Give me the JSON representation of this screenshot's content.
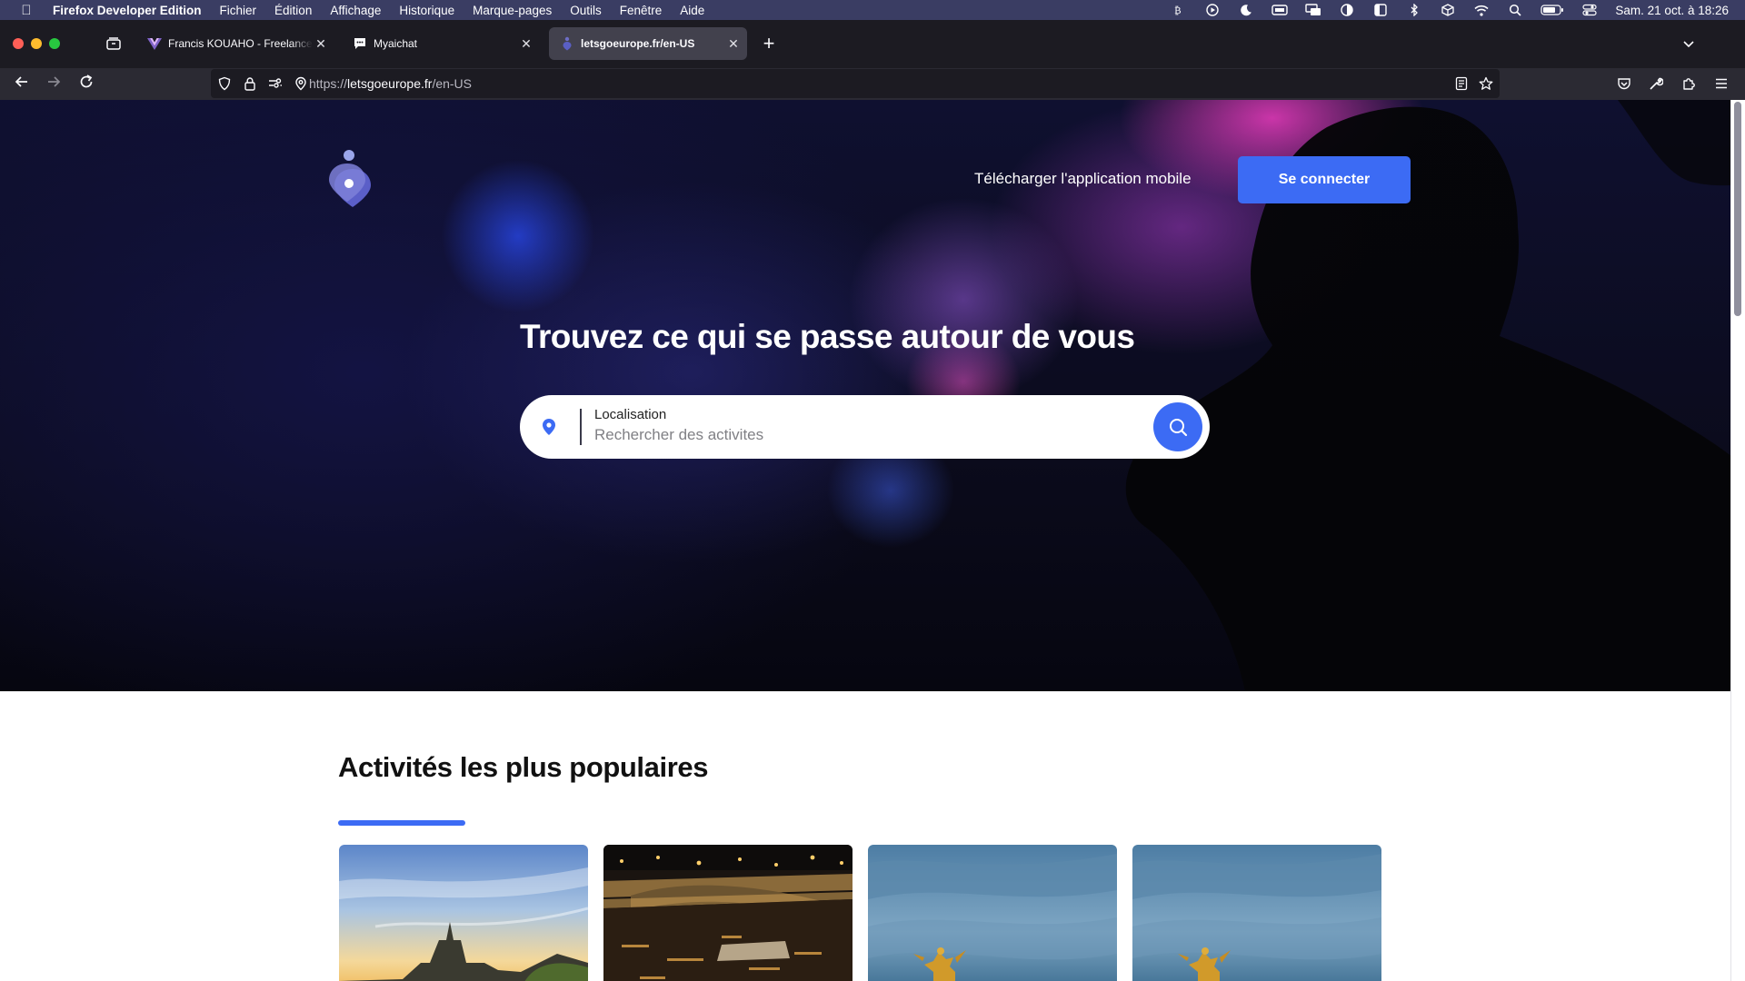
{
  "menubar": {
    "app_name": "Firefox Developer Edition",
    "menus": [
      "Fichier",
      "Édition",
      "Affichage",
      "Historique",
      "Marque-pages",
      "Outils",
      "Fenêtre",
      "Aide"
    ],
    "clock": "Sam. 21 oct. à 18:26"
  },
  "tabs": [
    {
      "title": "Francis KOUAHO - Freelance de",
      "favicon": "vue-icon",
      "active": false
    },
    {
      "title": "Myaichat",
      "favicon": "chat-icon",
      "active": false
    },
    {
      "title": "letsgoeurope.fr/en-US",
      "favicon": "letsgo-icon",
      "active": true
    }
  ],
  "navbar": {
    "url_scheme": "https://",
    "url_domain": "letsgoeurope.fr",
    "url_path": "/en-US"
  },
  "page": {
    "download_link": "Télécharger l'application mobile",
    "login_button": "Se connecter",
    "hero_title": "Trouvez ce qui se passe autour de vous",
    "search": {
      "label": "Localisation",
      "placeholder": "Rechercher des activites"
    },
    "popular_title": "Activités les plus populaires",
    "accent_color": "#3c6bf4",
    "cards": [
      {
        "name": "notre-dame-photo"
      },
      {
        "name": "seine-bridge-night-photo"
      },
      {
        "name": "golden-statue-photo"
      },
      {
        "name": "golden-statue-photo"
      }
    ]
  }
}
